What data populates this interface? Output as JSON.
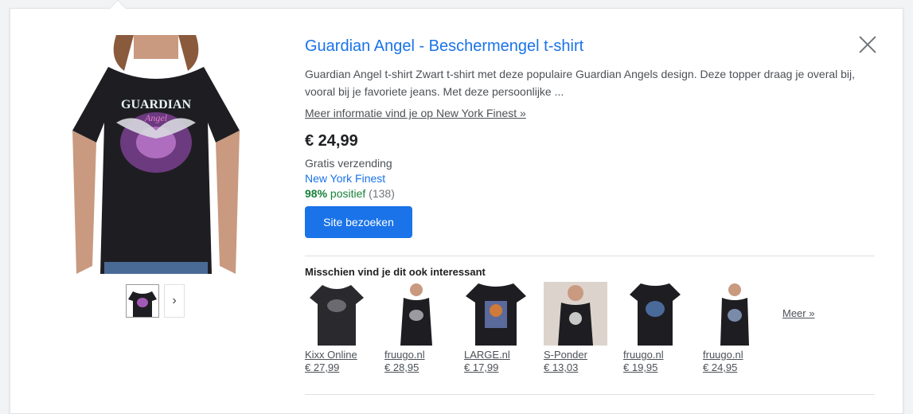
{
  "product": {
    "title": "Guardian Angel - Beschermengel t-shirt",
    "description": "Guardian Angel t-shirt Zwart t-shirt met deze populaire Guardian Angels design. Deze topper draag je overal bij, vooral bij je favoriete jeans. Met deze persoonlijke ...",
    "more_info": "Meer informatie vind je op New York Finest »",
    "price": "€ 24,99",
    "shipping": "Gratis verzending",
    "merchant": "New York Finest",
    "rating_pct": "98%",
    "rating_label": "positief",
    "rating_count": "(138)",
    "visit_button": "Site bezoeken",
    "print_text_1": "GUARDIAN",
    "print_text_2": "Angel"
  },
  "related": {
    "title": "Misschien vind je dit ook interessant",
    "more": "Meer »",
    "items": [
      {
        "store": "Kixx Online",
        "price": "€ 27,99"
      },
      {
        "store": "fruugo.nl",
        "price": "€ 28,95"
      },
      {
        "store": "LARGE.nl",
        "price": "€ 17,99"
      },
      {
        "store": "S-Ponder",
        "price": "€ 13,03"
      },
      {
        "store": "fruugo.nl",
        "price": "€ 19,95"
      },
      {
        "store": "fruugo.nl",
        "price": "€ 24,95"
      }
    ]
  },
  "colors": {
    "accent": "#1a73e8",
    "positive": "#188038",
    "shirt": "#1e1e22"
  },
  "icons": {
    "close": "close-icon",
    "next": "chevron-right-icon"
  }
}
